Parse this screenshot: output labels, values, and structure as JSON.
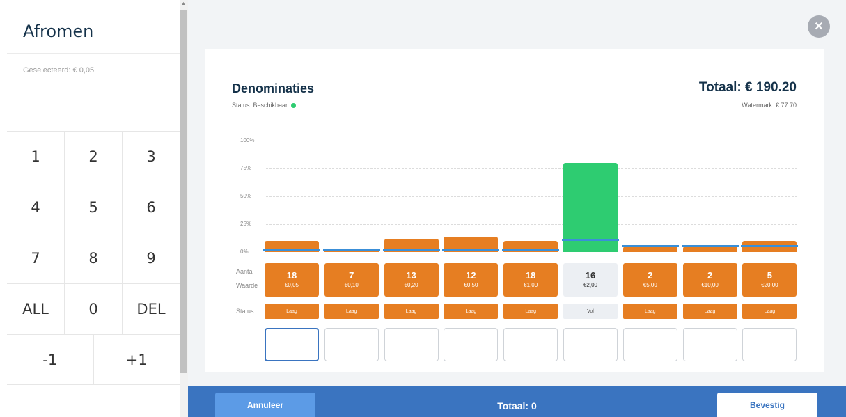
{
  "left": {
    "title": "Afromen",
    "selected": "Geselecteerd: € 0,05",
    "keys": [
      [
        "1",
        "2",
        "3"
      ],
      [
        "4",
        "5",
        "6"
      ],
      [
        "7",
        "8",
        "9"
      ],
      [
        "ALL",
        "0",
        "DEL"
      ],
      [
        "-1",
        "+1"
      ]
    ]
  },
  "card": {
    "title": "Denominaties",
    "status": "Status: Beschikbaar",
    "total": "Totaal: € 190.20",
    "watermark": "Watermark: € 77.70"
  },
  "chart_data": {
    "type": "bar",
    "y_ticks": [
      "100%",
      "75%",
      "50%",
      "25%",
      "0%"
    ],
    "ylim": [
      0,
      100
    ],
    "row_labels": {
      "aantal": "Aantal",
      "waarde": "Waarde",
      "status": "Status"
    },
    "categories": [
      "€0,05",
      "€0,10",
      "€0,20",
      "€0,50",
      "€1,00",
      "€2,00",
      "€5,00",
      "€10,00",
      "€20,00"
    ],
    "counts": [
      "18",
      "7",
      "13",
      "12",
      "18",
      "16",
      "2",
      "2",
      "5"
    ],
    "values": [
      10,
      3,
      12,
      14,
      10,
      80,
      5,
      5,
      10
    ],
    "watermark_levels": [
      3,
      3,
      3,
      3,
      3,
      12,
      6,
      6,
      6
    ],
    "status": [
      "Laag",
      "Laag",
      "Laag",
      "Laag",
      "Laag",
      "Vol",
      "Laag",
      "Laag",
      "Laag"
    ],
    "colors": {
      "low": "#e67e22",
      "full": "#2ecc71",
      "full_cell": "#eceff3",
      "watermark": "#3a8fd8"
    }
  },
  "footer": {
    "cancel": "Annuleer",
    "total": "Totaal: 0",
    "confirm": "Bevestig"
  }
}
